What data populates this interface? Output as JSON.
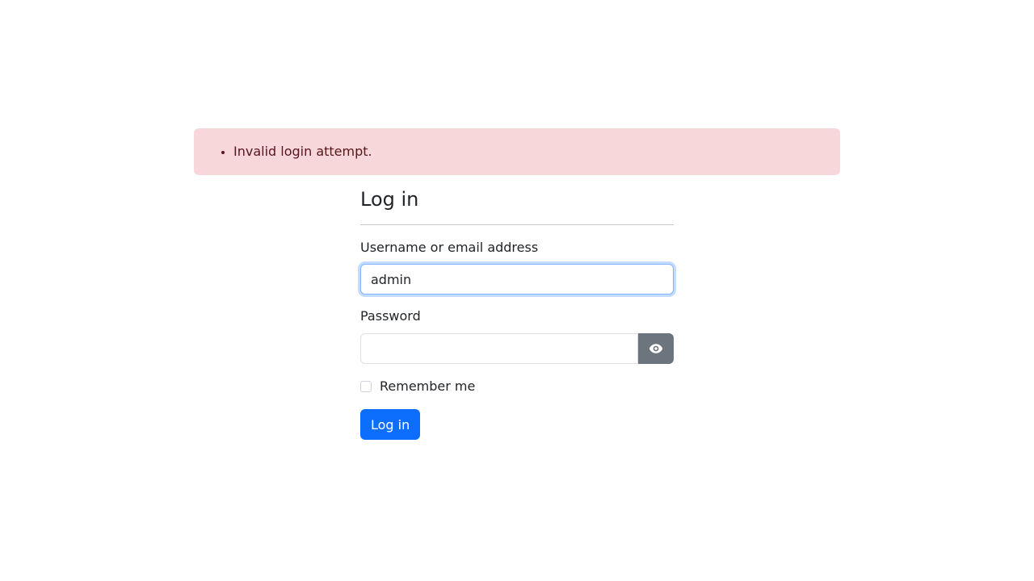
{
  "alert": {
    "errors": [
      "Invalid login attempt."
    ],
    "background": "#f8d7da",
    "text_color": "#58151c"
  },
  "form": {
    "title": "Log in",
    "username_label": "Username or email address",
    "username_value": "admin",
    "password_label": "Password",
    "password_value": "",
    "toggle_icon": "eye-icon",
    "remember_label": "Remember me",
    "remember_checked": false,
    "submit_label": "Log in"
  },
  "colors": {
    "primary": "#0d6efd",
    "secondary": "#6c757d",
    "focus_border": "#86b7fe"
  }
}
